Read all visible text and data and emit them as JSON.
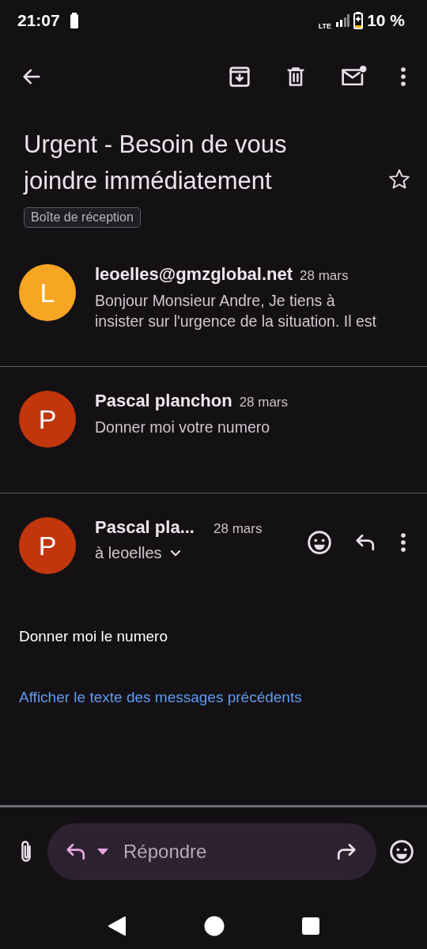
{
  "status_bar": {
    "time": "21:07",
    "network": "LTE",
    "battery": "10 %"
  },
  "thread": {
    "subject": "Urgent - Besoin de vous joindre immédiatement",
    "starred": false,
    "label": "Boîte de réception"
  },
  "messages": [
    {
      "initial": "L",
      "color": "#f6a623",
      "sender": "leoelles@gmzglobal.net",
      "date": "28 mars",
      "snippet": "Bonjour Monsieur Andre, Je tiens à insister sur l'urgence de la situation. Il est"
    },
    {
      "initial": "P",
      "color": "#c2360d",
      "sender": "Pascal planchon",
      "date": "28 mars",
      "snippet": "Donner moi votre numero"
    }
  ],
  "open_message": {
    "initial": "P",
    "color": "#c2360d",
    "sender": "Pascal pla...",
    "date": "28 mars",
    "recipient": "à leoelles",
    "body": "Donner moi le numero",
    "link": "Afficher le texte des messages précédents"
  },
  "reply_bar": {
    "placeholder": "Répondre"
  }
}
